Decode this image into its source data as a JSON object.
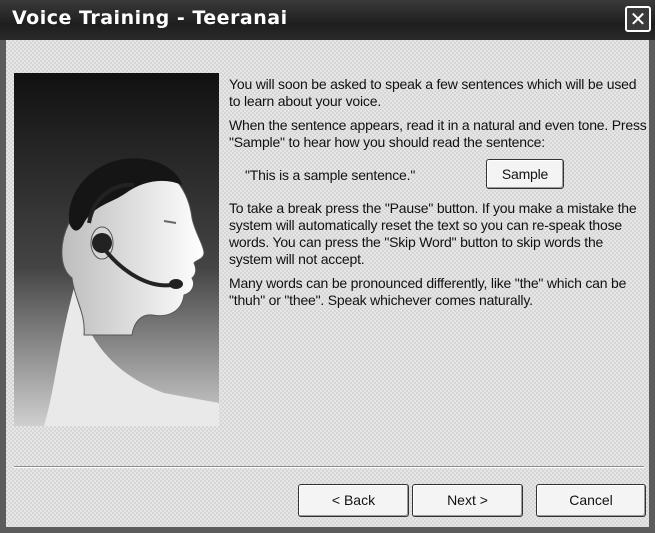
{
  "window": {
    "title": "Voice Training - Teeranai",
    "close_glyph": "✕"
  },
  "content": {
    "paragraphs": [
      "You will soon be asked to speak a few sentences which will be used to learn about your voice.",
      "When the sentence appears, read it in a natural and even tone. Press \"Sample\" to hear how you should read the sentence:",
      "To take a break press the \"Pause\" button. If you make a mistake the system will automatically reset the text so you can re-speak those words. You can press the \"Skip Word\" button to skip words the system will not accept.",
      "Many words can be pronounced differently, like \"the\" which can be \"thuh\" or \"thee\". Speak whichever comes naturally."
    ],
    "sample_sentence": "\"This is a sample sentence.\"",
    "sample_button": "Sample"
  },
  "buttons": {
    "back": "< Back",
    "next": "Next >",
    "cancel": "Cancel"
  },
  "illustration": {
    "icon": "person-with-headset-icon"
  }
}
